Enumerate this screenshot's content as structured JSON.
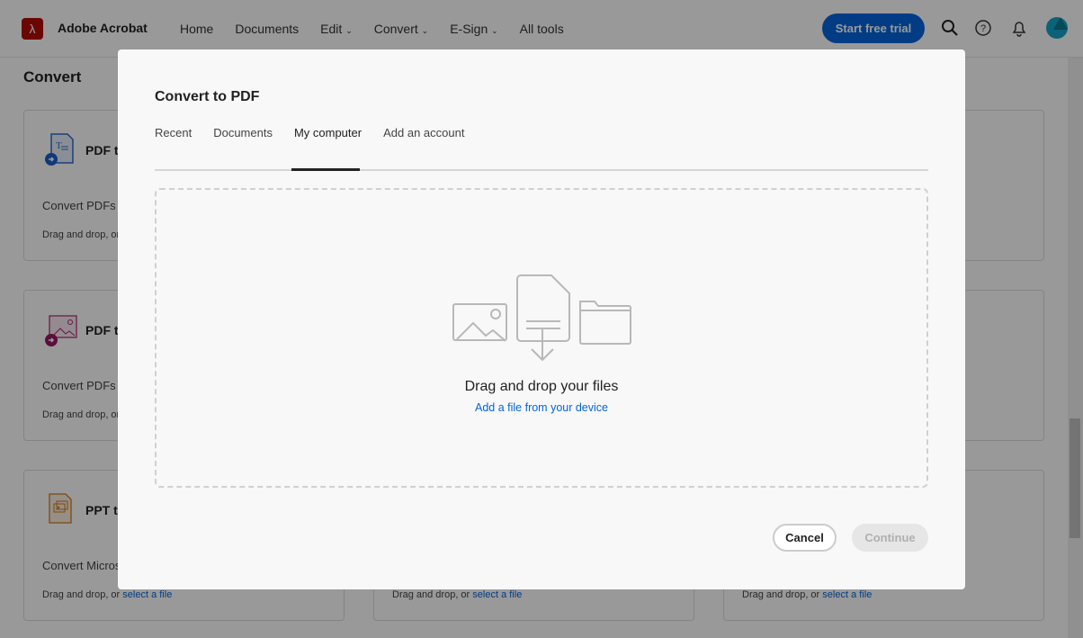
{
  "header": {
    "brand": "Adobe Acrobat",
    "nav": [
      "Home",
      "Documents",
      "Edit",
      "Convert",
      "E-Sign",
      "All tools"
    ],
    "trial_button": "Start free trial",
    "accent": "#0265dc"
  },
  "page": {
    "heading": "Convert",
    "cards": [
      {
        "title": "PDF t",
        "desc": "Convert PDFs t",
        "drop": "Drag and drop, or"
      },
      {
        "title": "PDF t",
        "desc": "Convert PDFs t",
        "drop": "Drag and drop, or"
      },
      {
        "title": "PPT t",
        "desc": "Convert Micros",
        "drop": "Drag and drop, or ",
        "link": "select a file"
      },
      {
        "drop": "Drag and drop, or ",
        "link": "select a file"
      },
      {
        "drop": "Drag and drop, or ",
        "link": "select a file"
      }
    ]
  },
  "modal": {
    "title": "Convert to PDF",
    "tabs": [
      "Recent",
      "Documents",
      "My computer",
      "Add an account"
    ],
    "active_tab": "My computer",
    "drop_text": "Drag and drop your files",
    "drop_link": "Add a file from your device",
    "cancel": "Cancel",
    "continue": "Continue"
  }
}
